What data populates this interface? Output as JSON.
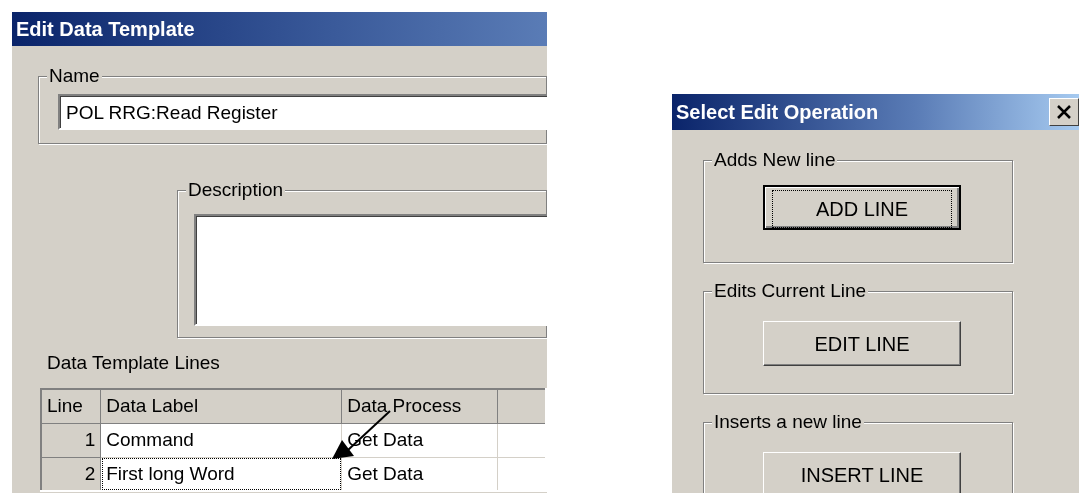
{
  "edit_window": {
    "title": "Edit Data Template",
    "name_group": {
      "label": "Name",
      "value": "POL RRG:Read Register"
    },
    "description_group": {
      "label": "Description"
    },
    "lines_label": "Data Template Lines",
    "table": {
      "columns": [
        "Line",
        "Data Label",
        "Data Process"
      ],
      "rows": [
        {
          "line": "1",
          "label": "Command",
          "process": "Get Data",
          "focused": false
        },
        {
          "line": "2",
          "label": "First long Word",
          "process": "Get Data",
          "focused": true
        }
      ]
    }
  },
  "operation_window": {
    "title": "Select Edit Operation",
    "groups": [
      {
        "label": "Adds New line",
        "button": "ADD LINE",
        "focused": true
      },
      {
        "label": "Edits Current Line",
        "button": "EDIT LINE",
        "focused": false
      },
      {
        "label": "Inserts a new line",
        "button": "INSERT LINE",
        "focused": false
      }
    ]
  }
}
